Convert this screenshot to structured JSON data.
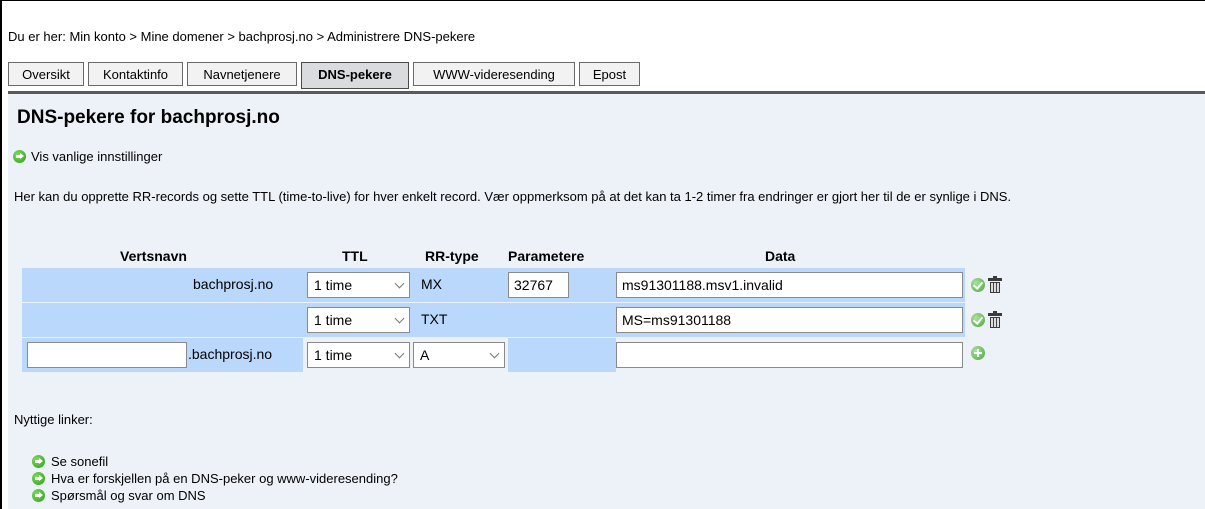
{
  "breadcrumb": {
    "prefix": "Du er her:",
    "path": "Min konto > Mine domener > bachprosj.no > Administrere DNS-pekere"
  },
  "tabs": [
    {
      "label": "Oversikt",
      "active": false
    },
    {
      "label": "Kontaktinfo",
      "active": false
    },
    {
      "label": "Navnetjenere",
      "active": false
    },
    {
      "label": "DNS-pekere",
      "active": true
    },
    {
      "label": "WWW-videresending",
      "active": false
    },
    {
      "label": "Epost",
      "active": false
    }
  ],
  "page": {
    "title": "DNS-pekere for bachprosj.no",
    "toggle_link": "Vis vanlige innstillinger",
    "intro": "Her kan du opprette RR-records og sette TTL (time-to-live) for hver enkelt record. Vær oppmerksom på at det kan ta 1-2 timer fra endringer er gjort her til de er synlige i DNS."
  },
  "table": {
    "headers": {
      "host": "Vertsnavn",
      "ttl": "TTL",
      "rrtype": "RR-type",
      "params": "Parametere",
      "data": "Data"
    },
    "rows": [
      {
        "host": "bachprosj.no",
        "ttl": "1 time",
        "type": "MX",
        "param": "32767",
        "data": "ms91301188.msv1.invalid"
      },
      {
        "host": "",
        "ttl": "1 time",
        "type": "TXT",
        "param": "",
        "data": "MS=ms91301188"
      }
    ],
    "new_row": {
      "host_value": "",
      "domain_suffix": ".bachprosj.no",
      "ttl": "1 time",
      "type": "A",
      "data_value": ""
    }
  },
  "useful_links": {
    "heading": "Nyttige linker:",
    "items": [
      "Se sonefil",
      "Hva er forskjellen på en DNS-peker og www-videresending?",
      "Spørsmål og svar om DNS"
    ]
  },
  "icons": {
    "arrow": "green-arrow-circle-icon",
    "save": "green-check-icon",
    "delete": "trash-icon",
    "add": "green-plus-icon"
  },
  "colors": {
    "row_bg": "#b9d8fb",
    "content_bg": "#edf2f8",
    "active_tab_bg": "#d9dbde"
  }
}
